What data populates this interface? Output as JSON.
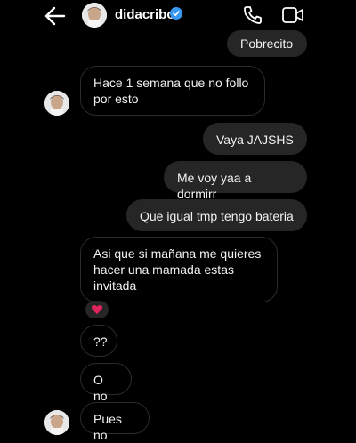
{
  "header": {
    "username": "didacribot",
    "icons": [
      "back-arrow-icon",
      "verified-icon",
      "phone-icon",
      "video-camera-icon"
    ]
  },
  "messages": [
    {
      "side": "sent",
      "text": "Pobrecito"
    },
    {
      "side": "received",
      "text": "Hace 1 semana que no follo\npor esto"
    },
    {
      "side": "sent",
      "text": "Vaya JAJSHS"
    },
    {
      "side": "sent",
      "text": "Me voy yaa a dormirr"
    },
    {
      "side": "sent",
      "text": "Que igual tmp tengo bateria"
    },
    {
      "side": "received",
      "text": "Asi que si mañana me quieres\nhacer una mamada estas\ninvitada"
    },
    {
      "side": "received",
      "text": "??"
    },
    {
      "side": "received",
      "text": "O no"
    },
    {
      "side": "received",
      "text": "Pues no"
    }
  ],
  "reaction": {
    "icon": "red-heart-icon",
    "color": "#e0245e"
  },
  "colors": {
    "background": "#000000",
    "sent_bubble": "#262626",
    "received_border": "#2b2b2b",
    "verified": "#3897f0"
  }
}
